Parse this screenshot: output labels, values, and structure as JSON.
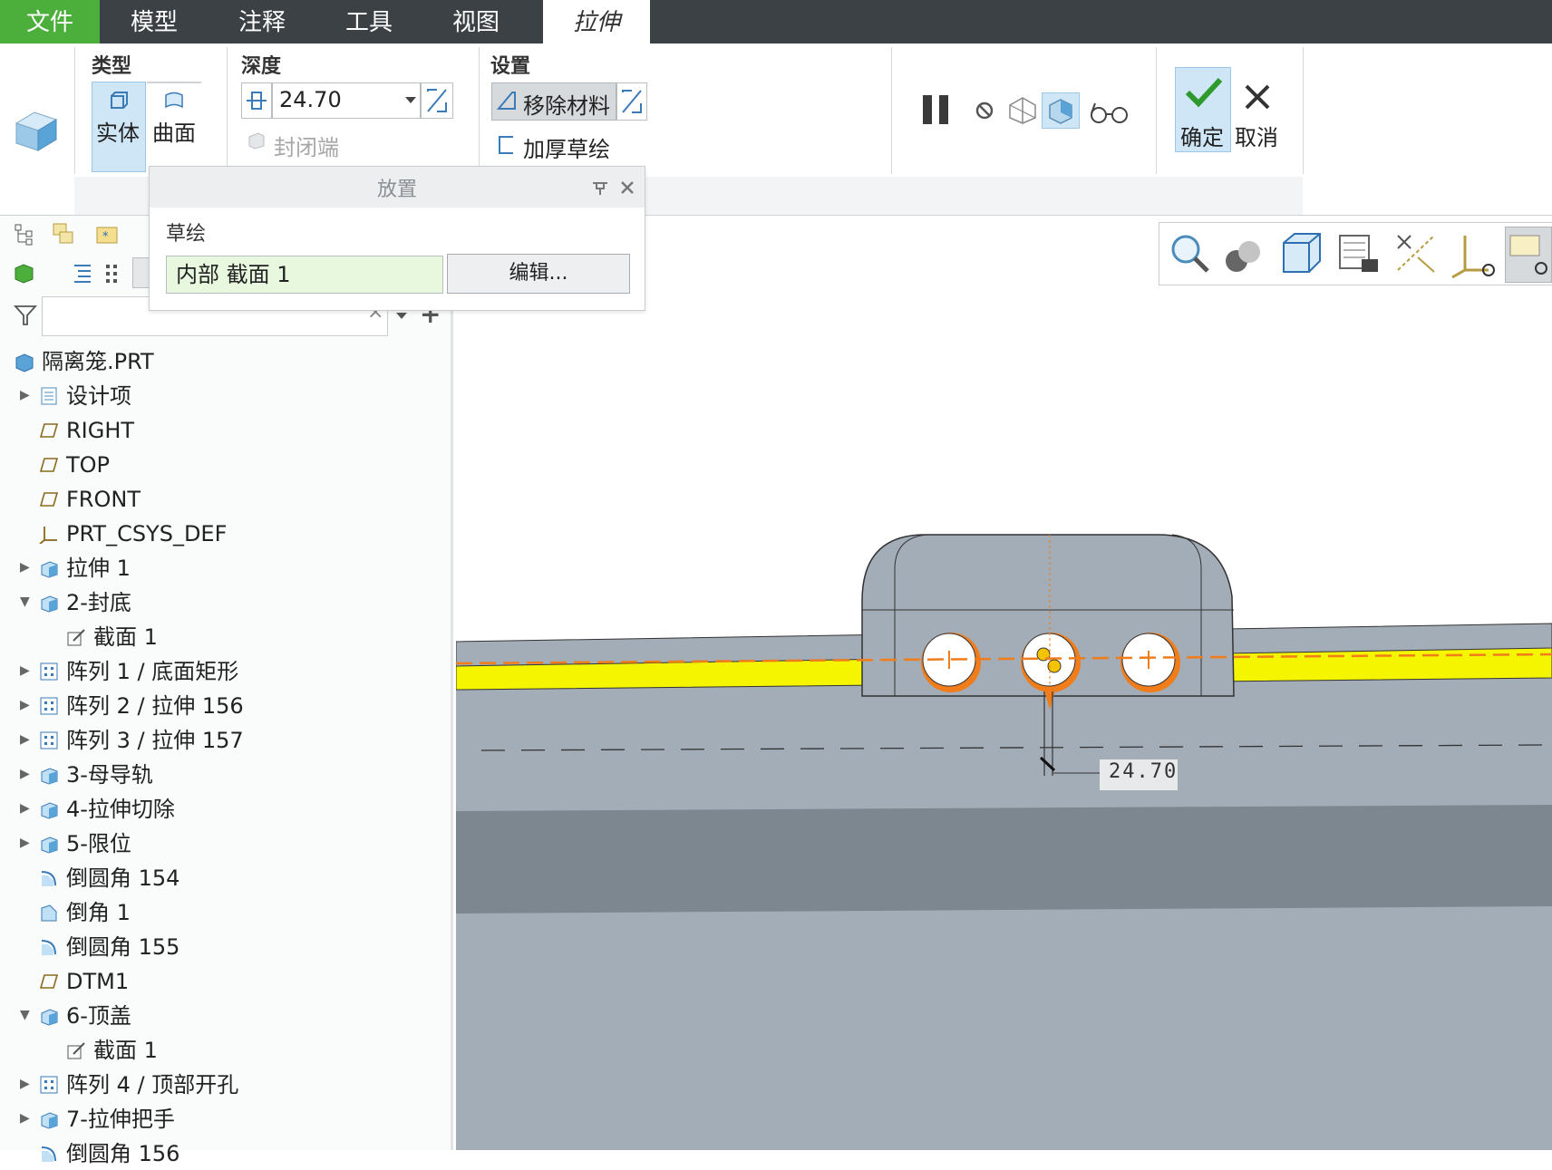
{
  "menu": {
    "file": "文件",
    "model": "模型",
    "annotate": "注释",
    "tools": "工具",
    "view": "视图",
    "extrude": "拉伸"
  },
  "ribbon": {
    "type_label": "类型",
    "solid_label": "实体",
    "surface_label": "曲面",
    "depth_label": "深度",
    "depth_value": "24.70",
    "capped_ends_label": "封闭端",
    "settings_label": "设置",
    "remove_material_label": "移除材料",
    "thicken_sketch_label": "加厚草绘",
    "ok_label": "确定",
    "cancel_label": "取消"
  },
  "placement": {
    "title": "放置",
    "sketch_label": "草绘",
    "sketch_value": "内部 截面 1",
    "edit_label": "编辑..."
  },
  "filter": {
    "clear_glyph": "×",
    "add_glyph": "+"
  },
  "tree": {
    "root": "隔离笼.PRT",
    "items": [
      {
        "label": "设计项",
        "icon": "design-items-icon",
        "expander": "▶",
        "indent": 0
      },
      {
        "label": "RIGHT",
        "icon": "datum-plane-icon",
        "expander": "",
        "indent": 0
      },
      {
        "label": "TOP",
        "icon": "datum-plane-icon",
        "expander": "",
        "indent": 0
      },
      {
        "label": "FRONT",
        "icon": "datum-plane-icon",
        "expander": "",
        "indent": 0
      },
      {
        "label": "PRT_CSYS_DEF",
        "icon": "csys-icon",
        "expander": "",
        "indent": 0
      },
      {
        "label": "拉伸 1",
        "icon": "extrude-icon",
        "expander": "▶",
        "indent": 0
      },
      {
        "label": "2-封底",
        "icon": "extrude-icon",
        "expander": "▼",
        "indent": 0
      },
      {
        "label": "截面 1",
        "icon": "sketch-icon",
        "expander": "",
        "indent": 1
      },
      {
        "label": "阵列 1 / 底面矩形",
        "icon": "pattern-icon",
        "expander": "▶",
        "indent": 0
      },
      {
        "label": "阵列 2 / 拉伸 156",
        "icon": "pattern-icon",
        "expander": "▶",
        "indent": 0
      },
      {
        "label": "阵列 3 / 拉伸 157",
        "icon": "pattern-icon",
        "expander": "▶",
        "indent": 0
      },
      {
        "label": "3-母导轨",
        "icon": "extrude-icon",
        "expander": "▶",
        "indent": 0
      },
      {
        "label": "4-拉伸切除",
        "icon": "extrude-icon",
        "expander": "▶",
        "indent": 0
      },
      {
        "label": "5-限位",
        "icon": "extrude-icon",
        "expander": "▶",
        "indent": 0
      },
      {
        "label": "倒圆角 154",
        "icon": "round-icon",
        "expander": "",
        "indent": 0
      },
      {
        "label": "倒角 1",
        "icon": "chamfer-icon",
        "expander": "",
        "indent": 0
      },
      {
        "label": "倒圆角 155",
        "icon": "round-icon",
        "expander": "",
        "indent": 0
      },
      {
        "label": "DTM1",
        "icon": "datum-plane-icon",
        "expander": "",
        "indent": 0
      },
      {
        "label": "6-顶盖",
        "icon": "extrude-icon",
        "expander": "▼",
        "indent": 0
      },
      {
        "label": "截面 1",
        "icon": "sketch-icon",
        "expander": "",
        "indent": 1
      },
      {
        "label": "阵列 4 / 顶部开孔",
        "icon": "pattern-icon",
        "expander": "▶",
        "indent": 0
      },
      {
        "label": "7-拉伸把手",
        "icon": "extrude-icon",
        "expander": "▶",
        "indent": 0
      },
      {
        "label": "倒圆角 156",
        "icon": "round-icon",
        "expander": "",
        "indent": 0
      }
    ]
  },
  "viewport": {
    "dimension_label": "24.70"
  },
  "colors": {
    "file_tab": "#4caf3c",
    "menubar": "#3b4145",
    "highlight": "#cfe6f6",
    "edit_field": "#e7f8df",
    "model_gray": "#a3adb7",
    "preview_orange": "#f07c1a",
    "yellow_band": "#f5f500"
  }
}
